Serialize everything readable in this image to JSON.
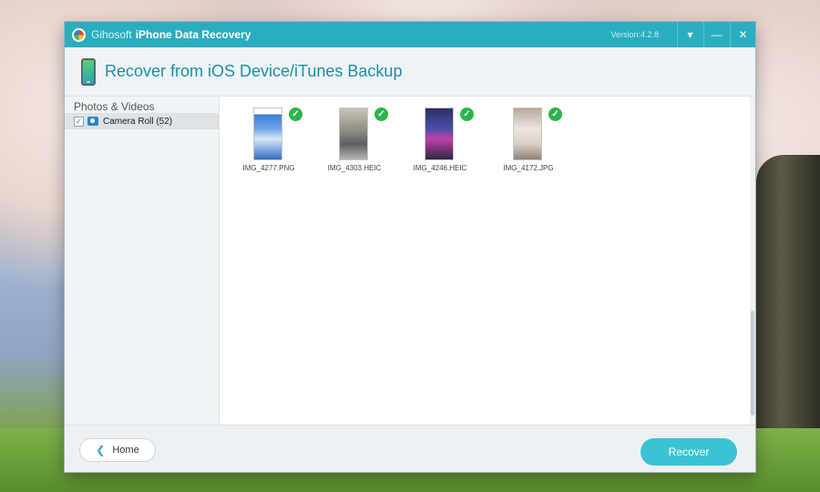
{
  "window": {
    "brand": "Gihosoft",
    "app_name": "iPhone Data Recovery",
    "version": "Version:4.2.8",
    "menu_icon": "dropdown-icon",
    "minimize_icon": "minimize-icon",
    "close_icon": "close-icon"
  },
  "header": {
    "title": "Recover from iOS Device/iTunes Backup",
    "icon": "phone-icon"
  },
  "sidebar": {
    "category": "Photos & Videos",
    "items": [
      {
        "label": "Camera Roll (52)",
        "checked": true,
        "icon": "album-icon"
      }
    ]
  },
  "photos": [
    {
      "name": "IMG_4277.PNG",
      "selected": true
    },
    {
      "name": "IMG_4303.HEIC",
      "selected": true
    },
    {
      "name": "IMG_4246.HEIC",
      "selected": true
    },
    {
      "name": "IMG_4172.JPG",
      "selected": true
    }
  ],
  "footer": {
    "home_label": "Home",
    "recover_label": "Recover"
  },
  "colors": {
    "accent": "#2aaebf",
    "recover_button": "#3cc3d3",
    "check_green": "#2db44a"
  }
}
